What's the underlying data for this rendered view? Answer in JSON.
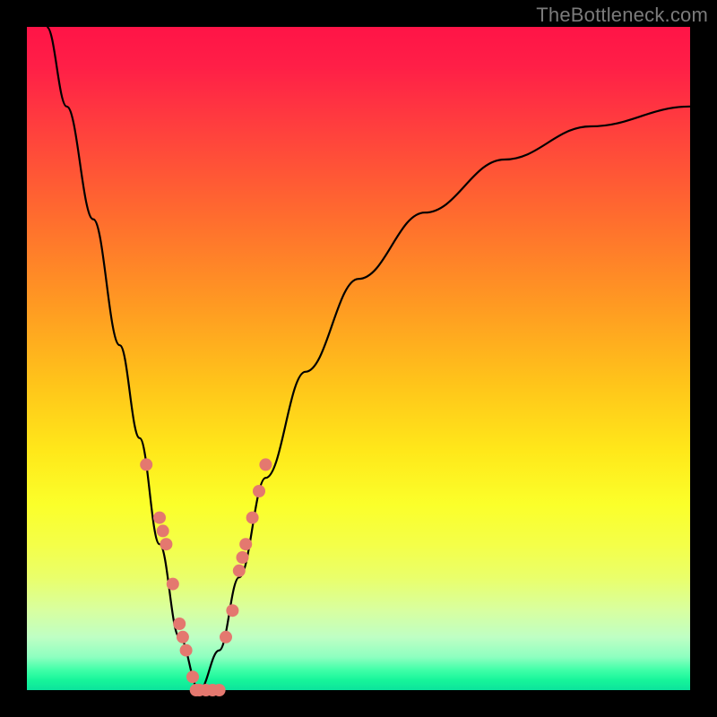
{
  "watermark": "TheBottleneck.com",
  "colors": {
    "curve_stroke": "#000000",
    "marker_fill": "#e4786f",
    "marker_stroke": "#c9615a"
  },
  "chart_data": {
    "type": "line",
    "title": "",
    "xlabel": "",
    "ylabel": "",
    "xlim": [
      0,
      100
    ],
    "ylim": [
      0,
      100
    ],
    "curve": {
      "description": "Bottleneck severity curve (V-shape). y = 100 means worst (top, red), y = 0 means best (bottom, green). Minimum at x ≈ 26.",
      "x_min_at": 26,
      "points": [
        {
          "x": 3,
          "y": 100
        },
        {
          "x": 6,
          "y": 88
        },
        {
          "x": 10,
          "y": 71
        },
        {
          "x": 14,
          "y": 52
        },
        {
          "x": 17,
          "y": 38
        },
        {
          "x": 20,
          "y": 22
        },
        {
          "x": 23,
          "y": 8
        },
        {
          "x": 26,
          "y": 0
        },
        {
          "x": 29,
          "y": 6
        },
        {
          "x": 32,
          "y": 17
        },
        {
          "x": 36,
          "y": 32
        },
        {
          "x": 42,
          "y": 48
        },
        {
          "x": 50,
          "y": 62
        },
        {
          "x": 60,
          "y": 72
        },
        {
          "x": 72,
          "y": 80
        },
        {
          "x": 85,
          "y": 85
        },
        {
          "x": 100,
          "y": 88
        }
      ]
    },
    "series": [
      {
        "name": "sample-points-left",
        "x": [
          18,
          20,
          20.5,
          21,
          22,
          23,
          23.5,
          24,
          25
        ],
        "y": [
          34,
          26,
          24,
          22,
          16,
          10,
          8,
          6,
          2
        ]
      },
      {
        "name": "sample-points-bottom",
        "x": [
          25.5,
          26,
          27,
          28,
          29
        ],
        "y": [
          0,
          0,
          0,
          0,
          0
        ]
      },
      {
        "name": "sample-points-right",
        "x": [
          30,
          31,
          32,
          32.5,
          33,
          34,
          35,
          36
        ],
        "y": [
          8,
          12,
          18,
          20,
          22,
          26,
          30,
          34
        ]
      }
    ]
  }
}
